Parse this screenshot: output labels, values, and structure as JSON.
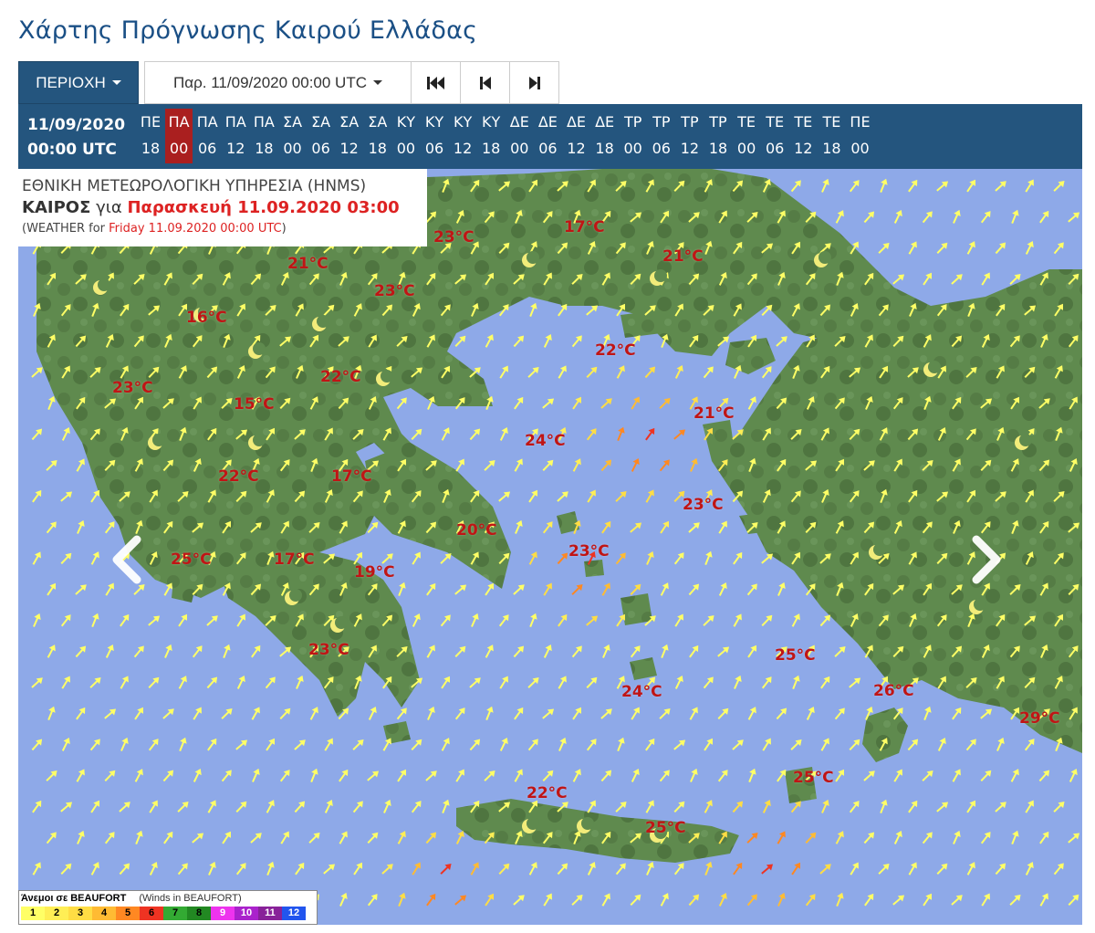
{
  "page_title": "Χάρτης Πρόγνωσης Καιρού Ελλάδας",
  "toolbar": {
    "region_label": "ΠΕΡΙΟΧΗ",
    "date_label": "Παρ. 11/09/2020 00:00 UTC",
    "nav_icons": [
      "skip-to-start-icon",
      "step-back-icon",
      "step-forward-icon"
    ]
  },
  "timebar": {
    "date": "11/09/2020",
    "time": "00:00 UTC",
    "selected_index": 1,
    "slots": [
      {
        "day": "ΠΕ",
        "hour": "18"
      },
      {
        "day": "ΠΑ",
        "hour": "00"
      },
      {
        "day": "ΠΑ",
        "hour": "06"
      },
      {
        "day": "ΠΑ",
        "hour": "12"
      },
      {
        "day": "ΠΑ",
        "hour": "18"
      },
      {
        "day": "ΣΑ",
        "hour": "00"
      },
      {
        "day": "ΣΑ",
        "hour": "06"
      },
      {
        "day": "ΣΑ",
        "hour": "12"
      },
      {
        "day": "ΣΑ",
        "hour": "18"
      },
      {
        "day": "ΚΥ",
        "hour": "00"
      },
      {
        "day": "ΚΥ",
        "hour": "06"
      },
      {
        "day": "ΚΥ",
        "hour": "12"
      },
      {
        "day": "ΚΥ",
        "hour": "18"
      },
      {
        "day": "ΔΕ",
        "hour": "00"
      },
      {
        "day": "ΔΕ",
        "hour": "06"
      },
      {
        "day": "ΔΕ",
        "hour": "12"
      },
      {
        "day": "ΔΕ",
        "hour": "18"
      },
      {
        "day": "ΤΡ",
        "hour": "00"
      },
      {
        "day": "ΤΡ",
        "hour": "06"
      },
      {
        "day": "ΤΡ",
        "hour": "12"
      },
      {
        "day": "ΤΡ",
        "hour": "18"
      },
      {
        "day": "ΤΕ",
        "hour": "00"
      },
      {
        "day": "ΤΕ",
        "hour": "06"
      },
      {
        "day": "ΤΕ",
        "hour": "12"
      },
      {
        "day": "ΤΕ",
        "hour": "18"
      },
      {
        "day": "ΠΕ",
        "hour": "00"
      }
    ]
  },
  "infobox": {
    "agency": "ΕΘΝΙΚΗ ΜΕΤΕΩΡΟΛΟΓΙΚΗ ΥΠΗΡΕΣΙΑ (HNMS)",
    "weather_word": "ΚΑΙΡΟΣ",
    "for_word": "για",
    "forecast_time": "Παρασκευή 11.09.2020 03:00",
    "english_prefix": "(WEATHER for",
    "english_time": "Friday 11.09.2020 00:00 UTC",
    "english_suffix": ")"
  },
  "temperatures": [
    "23°C",
    "17°C",
    "21°C",
    "21°C",
    "23°C",
    "16°C",
    "22°C",
    "22°C",
    "23°C",
    "15°C",
    "21°C",
    "24°C",
    "22°C",
    "17°C",
    "23°C",
    "20°C",
    "25°C",
    "17°C",
    "19°C",
    "23°C",
    "23°C",
    "25°C",
    "24°C",
    "26°C",
    "29°C",
    "25°C",
    "22°C",
    "25°C"
  ],
  "legend": {
    "title": "Άνεμοι σε BEAUFORT",
    "subtitle": "(Winds in BEAUFORT)",
    "scale": [
      {
        "label": "1",
        "color": "#ffff66"
      },
      {
        "label": "2",
        "color": "#ffee55"
      },
      {
        "label": "3",
        "color": "#ffdd44"
      },
      {
        "label": "4",
        "color": "#ffbb33"
      },
      {
        "label": "5",
        "color": "#ff8822"
      },
      {
        "label": "6",
        "color": "#ee3322"
      },
      {
        "label": "7",
        "color": "#33aa33"
      },
      {
        "label": "8",
        "color": "#228822"
      },
      {
        "label": "9",
        "color": "#ee33ee"
      },
      {
        "label": "10",
        "color": "#aa22cc"
      },
      {
        "label": "11",
        "color": "#882299"
      },
      {
        "label": "12",
        "color": "#2255ee"
      }
    ]
  },
  "colors": {
    "header_blue": "#24557e",
    "selected_red": "#aa1f1f",
    "sea": "#8ea9e8",
    "land": "#5f8a4e",
    "temp_text": "#c01515"
  }
}
